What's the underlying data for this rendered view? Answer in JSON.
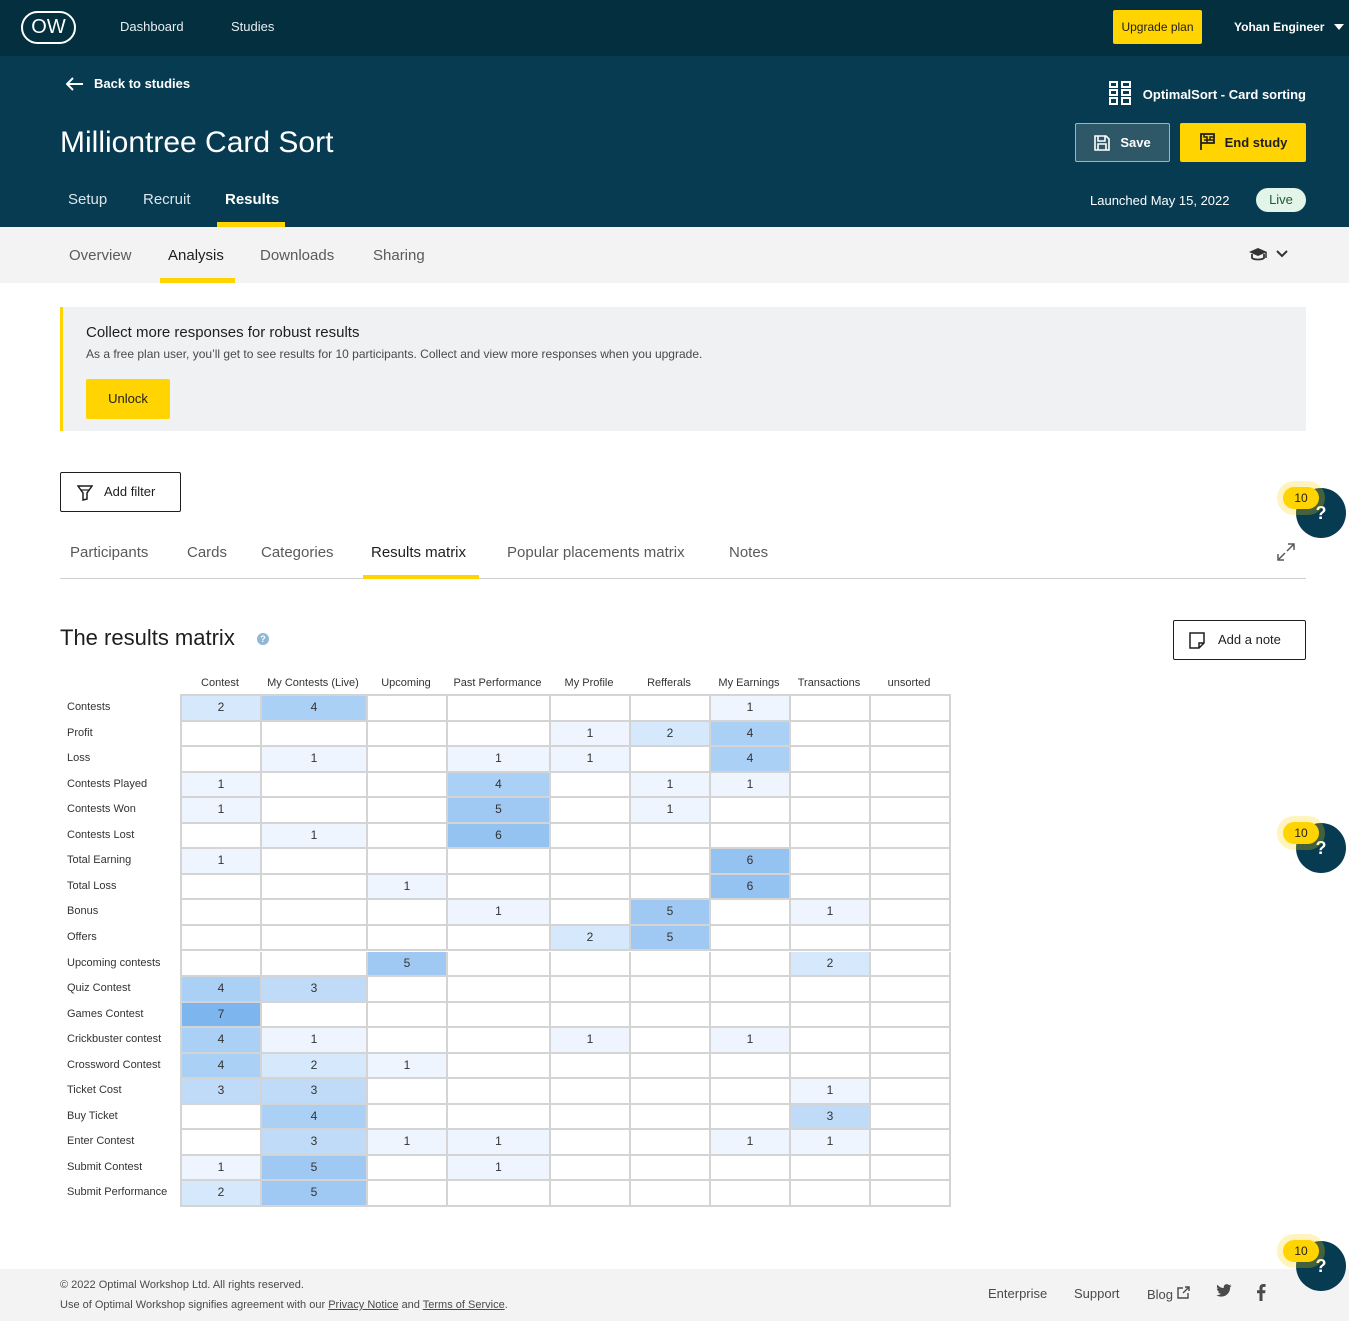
{
  "topnav": {
    "logo": "OW",
    "dashboard": "Dashboard",
    "studies": "Studies",
    "upgrade": "Upgrade plan",
    "user": "Yohan Engineer"
  },
  "header": {
    "back": "Back to studies",
    "study_type": "OptimalSort - Card sorting",
    "title": "Milliontree Card Sort",
    "save": "Save",
    "end_study": "End study",
    "tabs": [
      "Setup",
      "Recruit",
      "Results"
    ],
    "launched": "Launched May 15, 2022",
    "status": "Live"
  },
  "subnav": {
    "tabs": [
      "Overview",
      "Analysis",
      "Downloads",
      "Sharing"
    ]
  },
  "banner": {
    "title": "Collect more responses for robust results",
    "text": "As a free plan user, you’ll get to see results for 10 participants. Collect and view more responses when you upgrade.",
    "unlock": "Unlock"
  },
  "filter": {
    "label": "Add filter"
  },
  "result_tabs": [
    "Participants",
    "Cards",
    "Categories",
    "Results matrix",
    "Popular placements matrix",
    "Notes"
  ],
  "matrix": {
    "title": "The results matrix",
    "info": "?",
    "add_note": "Add a note",
    "columns": [
      "Contest",
      "My Contests (Live)",
      "Upcoming",
      "Past Performance",
      "My Profile",
      "Refferals",
      "My Earnings",
      "Transactions",
      "unsorted"
    ],
    "rows": [
      {
        "label": "Contests",
        "values": [
          2,
          4,
          null,
          null,
          null,
          null,
          1,
          null,
          null
        ]
      },
      {
        "label": "Profit",
        "values": [
          null,
          null,
          null,
          null,
          1,
          2,
          4,
          null,
          null
        ]
      },
      {
        "label": "Loss",
        "values": [
          null,
          1,
          null,
          1,
          1,
          null,
          4,
          null,
          null
        ]
      },
      {
        "label": "Contests Played",
        "values": [
          1,
          null,
          null,
          4,
          null,
          1,
          1,
          null,
          null
        ]
      },
      {
        "label": "Contests Won",
        "values": [
          1,
          null,
          null,
          5,
          null,
          1,
          null,
          null,
          null
        ]
      },
      {
        "label": "Contests Lost",
        "values": [
          null,
          1,
          null,
          6,
          null,
          null,
          null,
          null,
          null
        ]
      },
      {
        "label": "Total Earning",
        "values": [
          1,
          null,
          null,
          null,
          null,
          null,
          6,
          null,
          null
        ]
      },
      {
        "label": "Total Loss",
        "values": [
          null,
          null,
          1,
          null,
          null,
          null,
          6,
          null,
          null
        ]
      },
      {
        "label": "Bonus",
        "values": [
          null,
          null,
          null,
          1,
          null,
          5,
          null,
          1,
          null
        ]
      },
      {
        "label": "Offers",
        "values": [
          null,
          null,
          null,
          null,
          2,
          5,
          null,
          null,
          null
        ]
      },
      {
        "label": "Upcoming contests",
        "values": [
          null,
          null,
          5,
          null,
          null,
          null,
          null,
          2,
          null
        ]
      },
      {
        "label": "Quiz Contest",
        "values": [
          4,
          3,
          null,
          null,
          null,
          null,
          null,
          null,
          null
        ]
      },
      {
        "label": "Games Contest",
        "values": [
          7,
          null,
          null,
          null,
          null,
          null,
          null,
          null,
          null
        ]
      },
      {
        "label": "Crickbuster contest",
        "values": [
          4,
          1,
          null,
          null,
          1,
          null,
          1,
          null,
          null
        ]
      },
      {
        "label": "Crossword Contest",
        "values": [
          4,
          2,
          1,
          null,
          null,
          null,
          null,
          null,
          null
        ]
      },
      {
        "label": "Ticket Cost",
        "values": [
          3,
          3,
          null,
          null,
          null,
          null,
          null,
          1,
          null
        ]
      },
      {
        "label": "Buy Ticket",
        "values": [
          null,
          4,
          null,
          null,
          null,
          null,
          null,
          3,
          null
        ]
      },
      {
        "label": "Enter Contest",
        "values": [
          null,
          3,
          1,
          1,
          null,
          null,
          1,
          1,
          null
        ]
      },
      {
        "label": "Submit Contest",
        "values": [
          1,
          5,
          null,
          1,
          null,
          null,
          null,
          null,
          null
        ]
      },
      {
        "label": "Submit Performance",
        "values": [
          2,
          5,
          null,
          null,
          null,
          null,
          null,
          null,
          null
        ]
      }
    ]
  },
  "help": {
    "count": "10",
    "symbol": "?"
  },
  "footer": {
    "copyright": "© 2022 Optimal Workshop Ltd. All rights reserved.",
    "terms_prefix": "Use of Optimal Workshop signifies agreement with our",
    "privacy": "Privacy Notice",
    "and": "and",
    "terms": "Terms of Service",
    "period": ".",
    "enterprise": "Enterprise",
    "support": "Support",
    "blog": "Blog"
  },
  "colors": {
    "nav": "#032f3f",
    "header": "#063b52",
    "accent": "#ffd400",
    "cell_scale": [
      "#eef5fe",
      "#d6e8fb",
      "#c0dbf8",
      "#abd0f6",
      "#9fc8f3",
      "#94c2f1",
      "#7db6ee"
    ]
  }
}
